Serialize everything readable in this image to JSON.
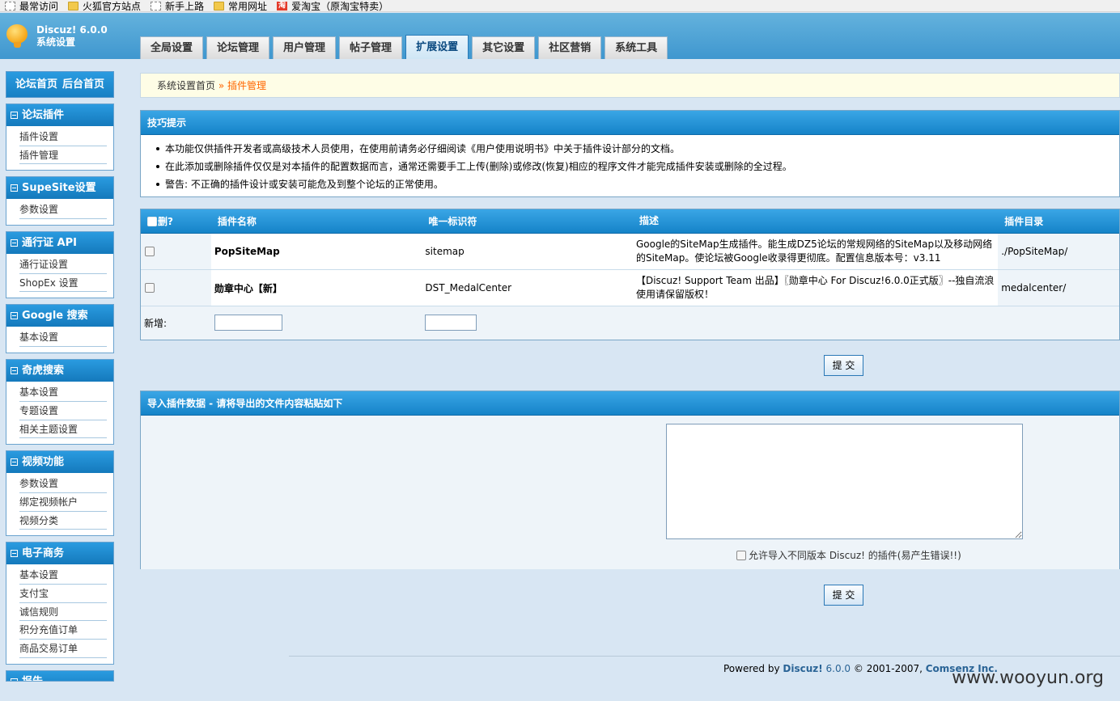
{
  "bookmarks": [
    {
      "label": "最常访问",
      "icon": "page-icon"
    },
    {
      "label": "火狐官方站点",
      "icon": "folder-icon"
    },
    {
      "label": "新手上路",
      "icon": "page-icon"
    },
    {
      "label": "常用网址",
      "icon": "folder-icon"
    },
    {
      "label": "爱淘宝（原淘宝特卖）",
      "icon": "taobao-icon",
      "icon_text": "淘"
    }
  ],
  "header": {
    "brand_line1": "Discuz! 6.0.0",
    "brand_line2": "系统设置",
    "tabs": [
      "全局设置",
      "论坛管理",
      "用户管理",
      "帖子管理",
      "扩展设置",
      "其它设置",
      "社区营销",
      "系统工具"
    ],
    "active_tab": "扩展设置"
  },
  "sidebar": {
    "home_links": [
      "论坛首页",
      "后台首页"
    ],
    "menus": [
      {
        "title": "论坛插件",
        "items": [
          "插件设置",
          "插件管理"
        ]
      },
      {
        "title": "SupeSite设置",
        "items": [
          "参数设置"
        ]
      },
      {
        "title": "通行证 API",
        "items": [
          "通行证设置",
          "ShopEx 设置"
        ]
      },
      {
        "title": "Google 搜索",
        "items": [
          "基本设置"
        ]
      },
      {
        "title": "奇虎搜索",
        "items": [
          "基本设置",
          "专题设置",
          "相关主题设置"
        ]
      },
      {
        "title": "视频功能",
        "items": [
          "参数设置",
          "绑定视频帐户",
          "视频分类"
        ]
      },
      {
        "title": "电子商务",
        "items": [
          "基本设置",
          "支付宝",
          "诚信规则",
          "积分充值订单",
          "商品交易订单"
        ]
      },
      {
        "title": "报告",
        "items": []
      }
    ]
  },
  "breadcrumb": {
    "home": "系统设置首页",
    "sep": " » ",
    "current": "插件管理"
  },
  "tips": {
    "title": "技巧提示",
    "items": [
      "本功能仅供插件开发者或高级技术人员使用，在使用前请务必仔细阅读《用户使用说明书》中关于插件设计部分的文档。",
      "在此添加或删除插件仅仅是对本插件的配置数据而言，通常还需要手工上传(删除)或修改(恢复)相应的程序文件才能完成插件安装或删除的全过程。",
      "警告: 不正确的插件设计或安装可能危及到整个论坛的正常使用。"
    ]
  },
  "plugins": {
    "columns": [
      "删?",
      "插件名称",
      "唯一标识符",
      "描述",
      "插件目录"
    ],
    "rows": [
      {
        "name": "PopSiteMap",
        "id": "sitemap",
        "desc": "Google的SiteMap生成插件。能生成DZ5论坛的常规网络的SiteMap以及移动网络的SiteMap。使论坛被Google收录得更彻底。配置信息版本号：v3.11",
        "dir": "./PopSiteMap/"
      },
      {
        "name": "勋章中心【新】",
        "id": "DST_MedalCenter",
        "desc": "【Discuz! Support Team 出品】〖勋章中心 For Discuz!6.0.0正式版〗--独自流浪使用请保留版权！",
        "dir": "medalcenter/"
      }
    ],
    "new_label": "新增:",
    "new_name_value": "",
    "new_id_value": ""
  },
  "submit_label": "提 交",
  "import": {
    "title": "导入插件数据 - 请将导出的文件内容粘贴如下",
    "textarea_value": "",
    "allow_label": "允许导入不同版本 Discuz! 的插件(易产生错误!!)"
  },
  "footer": {
    "powered": "Powered by ",
    "product": "Discuz!",
    "version": " 6.0.0",
    "copy": " © 2001-2007, ",
    "company": "Comsenz Inc."
  },
  "watermark": "www.wooyun.org"
}
